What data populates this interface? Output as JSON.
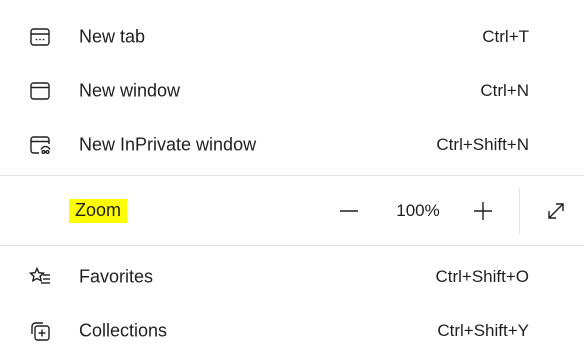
{
  "menu": {
    "new_tab": {
      "label": "New tab",
      "shortcut": "Ctrl+T",
      "icon": "new-tab-icon"
    },
    "new_window": {
      "label": "New window",
      "shortcut": "Ctrl+N",
      "icon": "new-window-icon"
    },
    "new_inprivate": {
      "label": "New InPrivate window",
      "shortcut": "Ctrl+Shift+N",
      "icon": "inprivate-window-icon"
    },
    "zoom": {
      "label": "Zoom",
      "value": "100%",
      "highlight_color": "#ffff00"
    },
    "favorites": {
      "label": "Favorites",
      "shortcut": "Ctrl+Shift+O",
      "icon": "favorites-icon"
    },
    "collections": {
      "label": "Collections",
      "shortcut": "Ctrl+Shift+Y",
      "icon": "collections-icon"
    }
  }
}
